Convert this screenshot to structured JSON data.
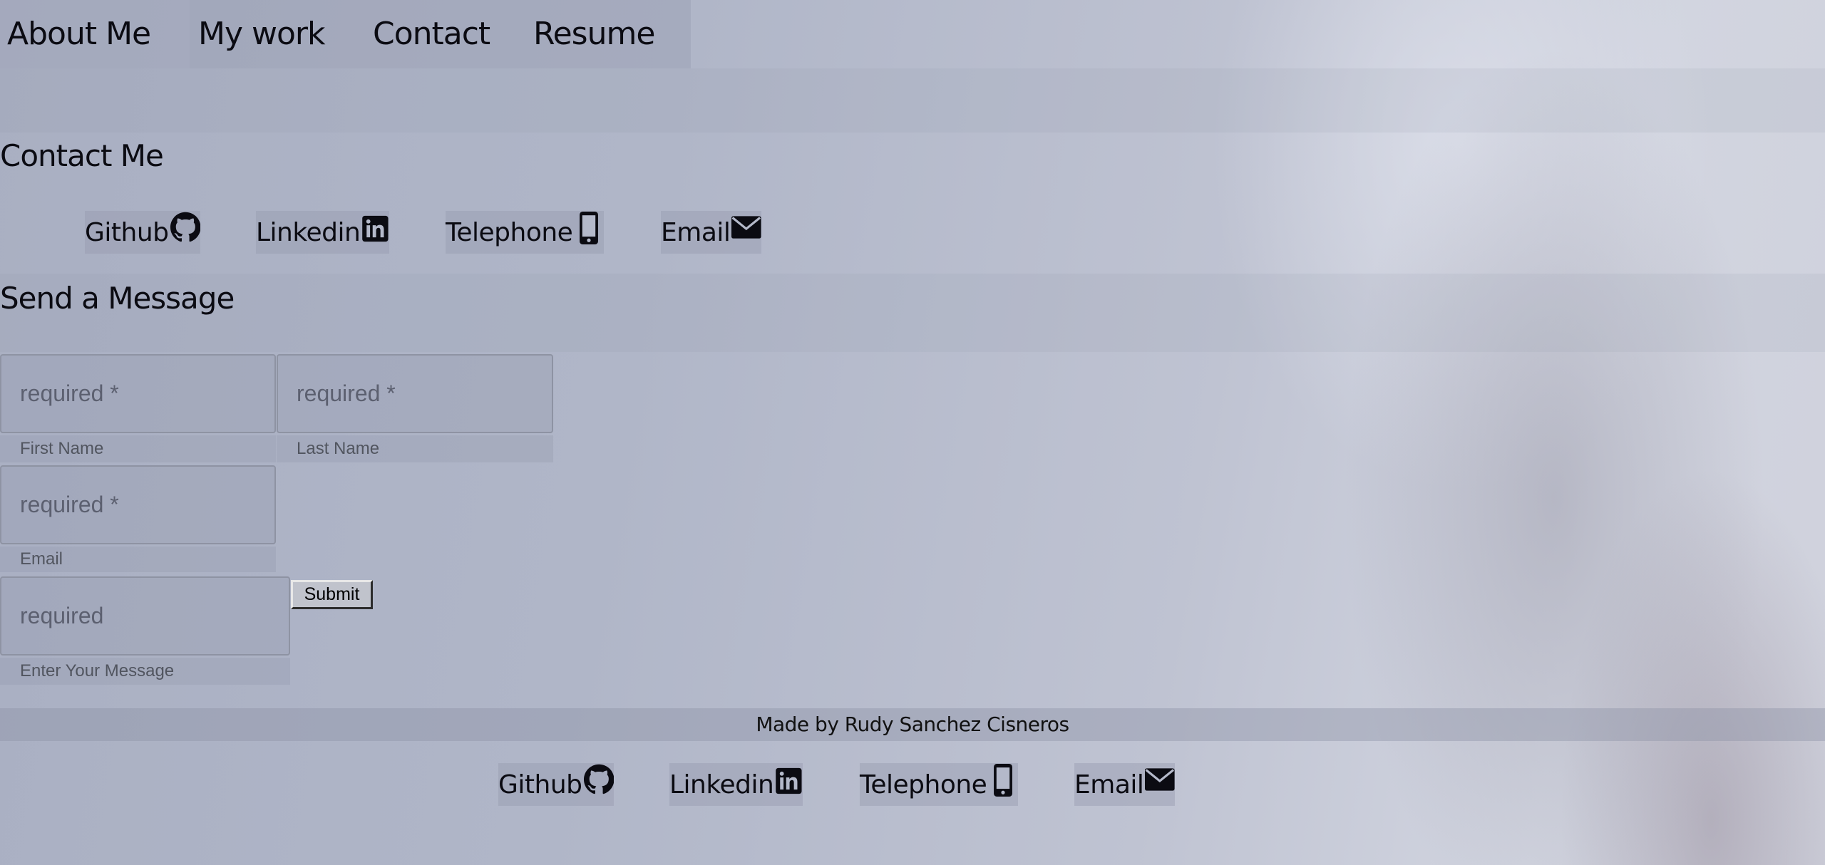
{
  "nav": {
    "items": [
      "About Me",
      "My work",
      "Contact",
      "Resume"
    ]
  },
  "contact": {
    "heading": "Contact Me",
    "links": [
      {
        "label": "Github",
        "icon": "github-icon"
      },
      {
        "label": "Linkedin",
        "icon": "linkedin-icon"
      },
      {
        "label": "Telephone",
        "icon": "phone-icon"
      },
      {
        "label": "Email",
        "icon": "envelope-icon"
      }
    ]
  },
  "message_form": {
    "heading": "Send a Message",
    "first_name": {
      "placeholder": "required *",
      "label": "First Name"
    },
    "last_name": {
      "placeholder": "required *",
      "label": "Last Name"
    },
    "email": {
      "placeholder": "required *",
      "label": "Email"
    },
    "message": {
      "placeholder": "required",
      "label": "Enter Your Message"
    },
    "submit_label": "Submit"
  },
  "footer": {
    "credit": "Made by Rudy Sanchez Cisneros",
    "links": [
      {
        "label": "Github",
        "icon": "github-icon"
      },
      {
        "label": "Linkedin",
        "icon": "linkedin-icon"
      },
      {
        "label": "Telephone",
        "icon": "phone-icon"
      },
      {
        "label": "Email",
        "icon": "envelope-icon"
      }
    ]
  },
  "colors": {
    "text": "#0b0b12",
    "background_start": "#a9afc2",
    "background_end": "#d2d5e0",
    "field_border": "#8e93a3",
    "placeholder": "#5c6070"
  }
}
